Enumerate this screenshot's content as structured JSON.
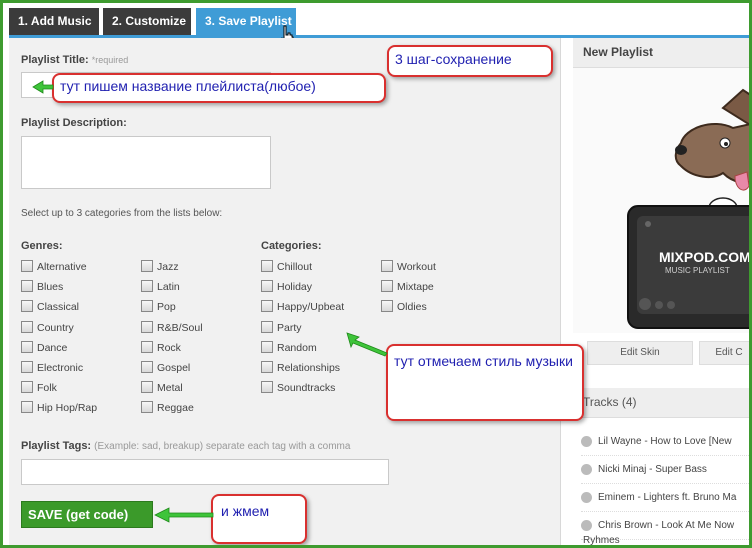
{
  "tabs": {
    "add_music": "1. Add Music",
    "customize": "2. Customize",
    "save_playlist": "3. Save Playlist"
  },
  "form": {
    "title_label": "Playlist Title:",
    "title_required": "*required",
    "description_label": "Playlist Description:",
    "categories_hint": "Select up to 3 categories from the lists below:",
    "genres_label": "Genres:",
    "categories_label": "Categories:",
    "genres": [
      "Alternative",
      "Blues",
      "Classical",
      "Country",
      "Dance",
      "Electronic",
      "Folk",
      "Hip Hop/Rap",
      "Jazz",
      "Latin",
      "Pop",
      "R&B/Soul",
      "Rock",
      "Gospel",
      "Metal",
      "Reggae"
    ],
    "categories": [
      "Chillout",
      "Holiday",
      "Happy/Upbeat",
      "Party",
      "Random",
      "Relationships",
      "Soundtracks",
      "Workout",
      "Mixtape",
      "Oldies"
    ],
    "tags_label": "Playlist Tags:",
    "tags_hint": "(Example: sad, breakup) separate each tag with a comma",
    "save_button": "SAVE (get code)"
  },
  "sidebar": {
    "new_playlist": "New Playlist",
    "logo_text": "MIXPOD.COM",
    "logo_sub": "MUSIC PLAYLIST",
    "edit_skin": "Edit Skin",
    "edit_other": "Edit C",
    "tracks_header": "Tracks (4)",
    "tracks": [
      "Lil Wayne - How to Love [New",
      "Nicki Minaj - Super Bass",
      "Eminem - Lighters ft. Bruno Ma",
      "Chris Brown - Look At Me Now"
    ],
    "track_overflow": "Ryhmes"
  },
  "annotations": {
    "step3": "3 шаг-сохранение",
    "title_note": "тут пишем название плейлиста(любое)",
    "style_note": "тут отмечаем стиль музыки",
    "press_note": "и жмем"
  },
  "colors": {
    "frame": "#3e9b2f",
    "active_tab": "#3f9cd6",
    "dark_tab": "#3b3b3b",
    "save_green": "#3b9a2a",
    "note_border": "#d9302f",
    "note_text": "#1f1fb0",
    "arrow_green": "#3ec43a"
  }
}
